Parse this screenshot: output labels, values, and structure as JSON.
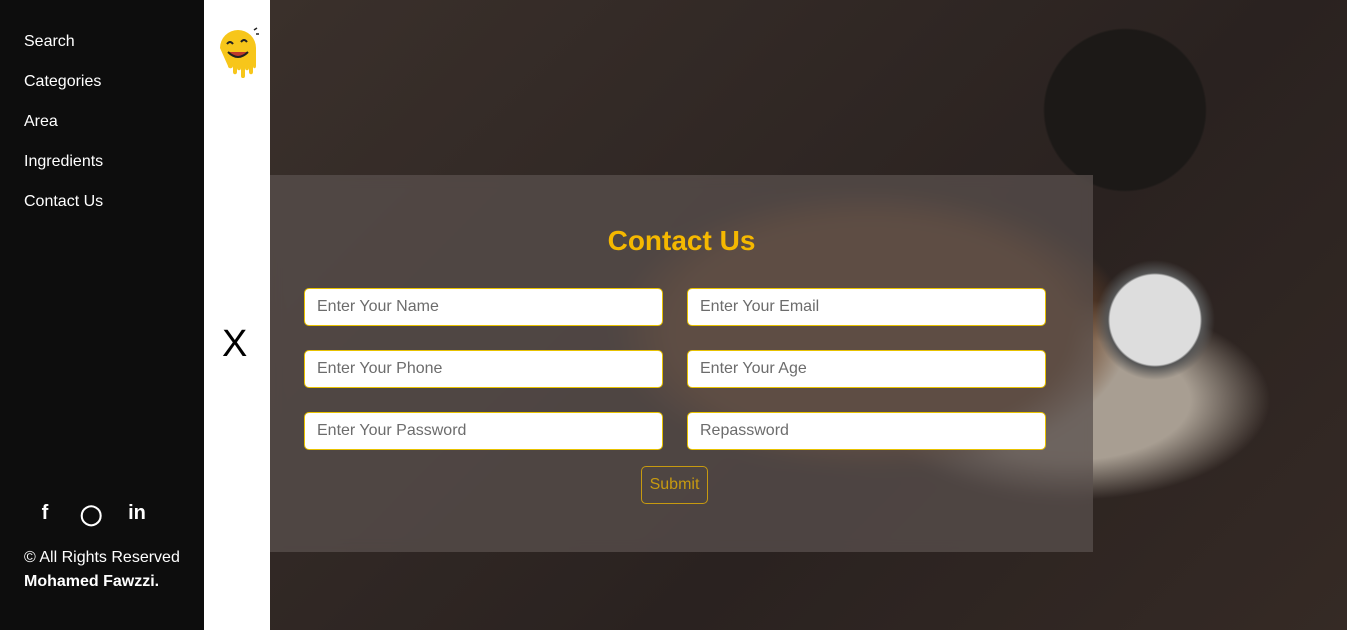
{
  "sidebar": {
    "items": [
      {
        "label": "Search"
      },
      {
        "label": "Categories"
      },
      {
        "label": "Area"
      },
      {
        "label": "Ingredients"
      },
      {
        "label": "Contact Us"
      }
    ],
    "social": [
      {
        "icon": "facebook-icon",
        "glyph": "f"
      },
      {
        "icon": "github-icon",
        "glyph": "◯"
      },
      {
        "icon": "linkedin-icon",
        "glyph": "in"
      }
    ],
    "copyright": "© All Rights Reserved",
    "author": "Mohamed Fawzzi."
  },
  "strip": {
    "logo": "smiley-logo",
    "close_glyph": "X"
  },
  "form": {
    "title": "Contact Us",
    "fields": {
      "name": "Enter Your Name",
      "email": "Enter Your Email",
      "phone": "Enter Your Phone",
      "age": "Enter Your Age",
      "password": "Enter Your Password",
      "repassword": "Repassword"
    },
    "submit": "Submit"
  },
  "colors": {
    "accent": "#f5b800",
    "sidebar": "#0d0d0d"
  }
}
